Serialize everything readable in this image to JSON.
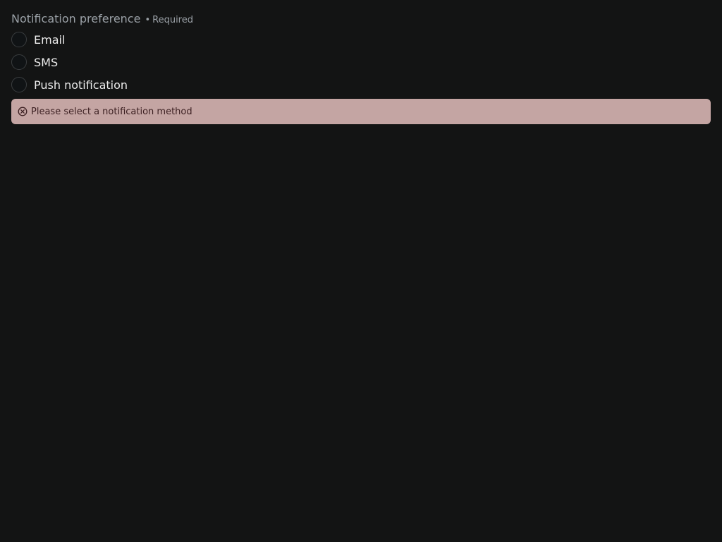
{
  "group": {
    "legend": "Notification preference",
    "separator": "•",
    "required_label": "Required"
  },
  "options": [
    {
      "label": "Email",
      "checked": false
    },
    {
      "label": "SMS",
      "checked": false
    },
    {
      "label": "Push notification",
      "checked": false
    }
  ],
  "error": {
    "icon": "circle-x-icon",
    "message": "Please select a notification method",
    "background_color": "#c4a5a3",
    "text_color": "#3b1f21"
  },
  "colors": {
    "background": "#131414",
    "legend_text": "#9aa0a6",
    "option_text": "#ececec",
    "radio_border": "#3a3d3f"
  }
}
